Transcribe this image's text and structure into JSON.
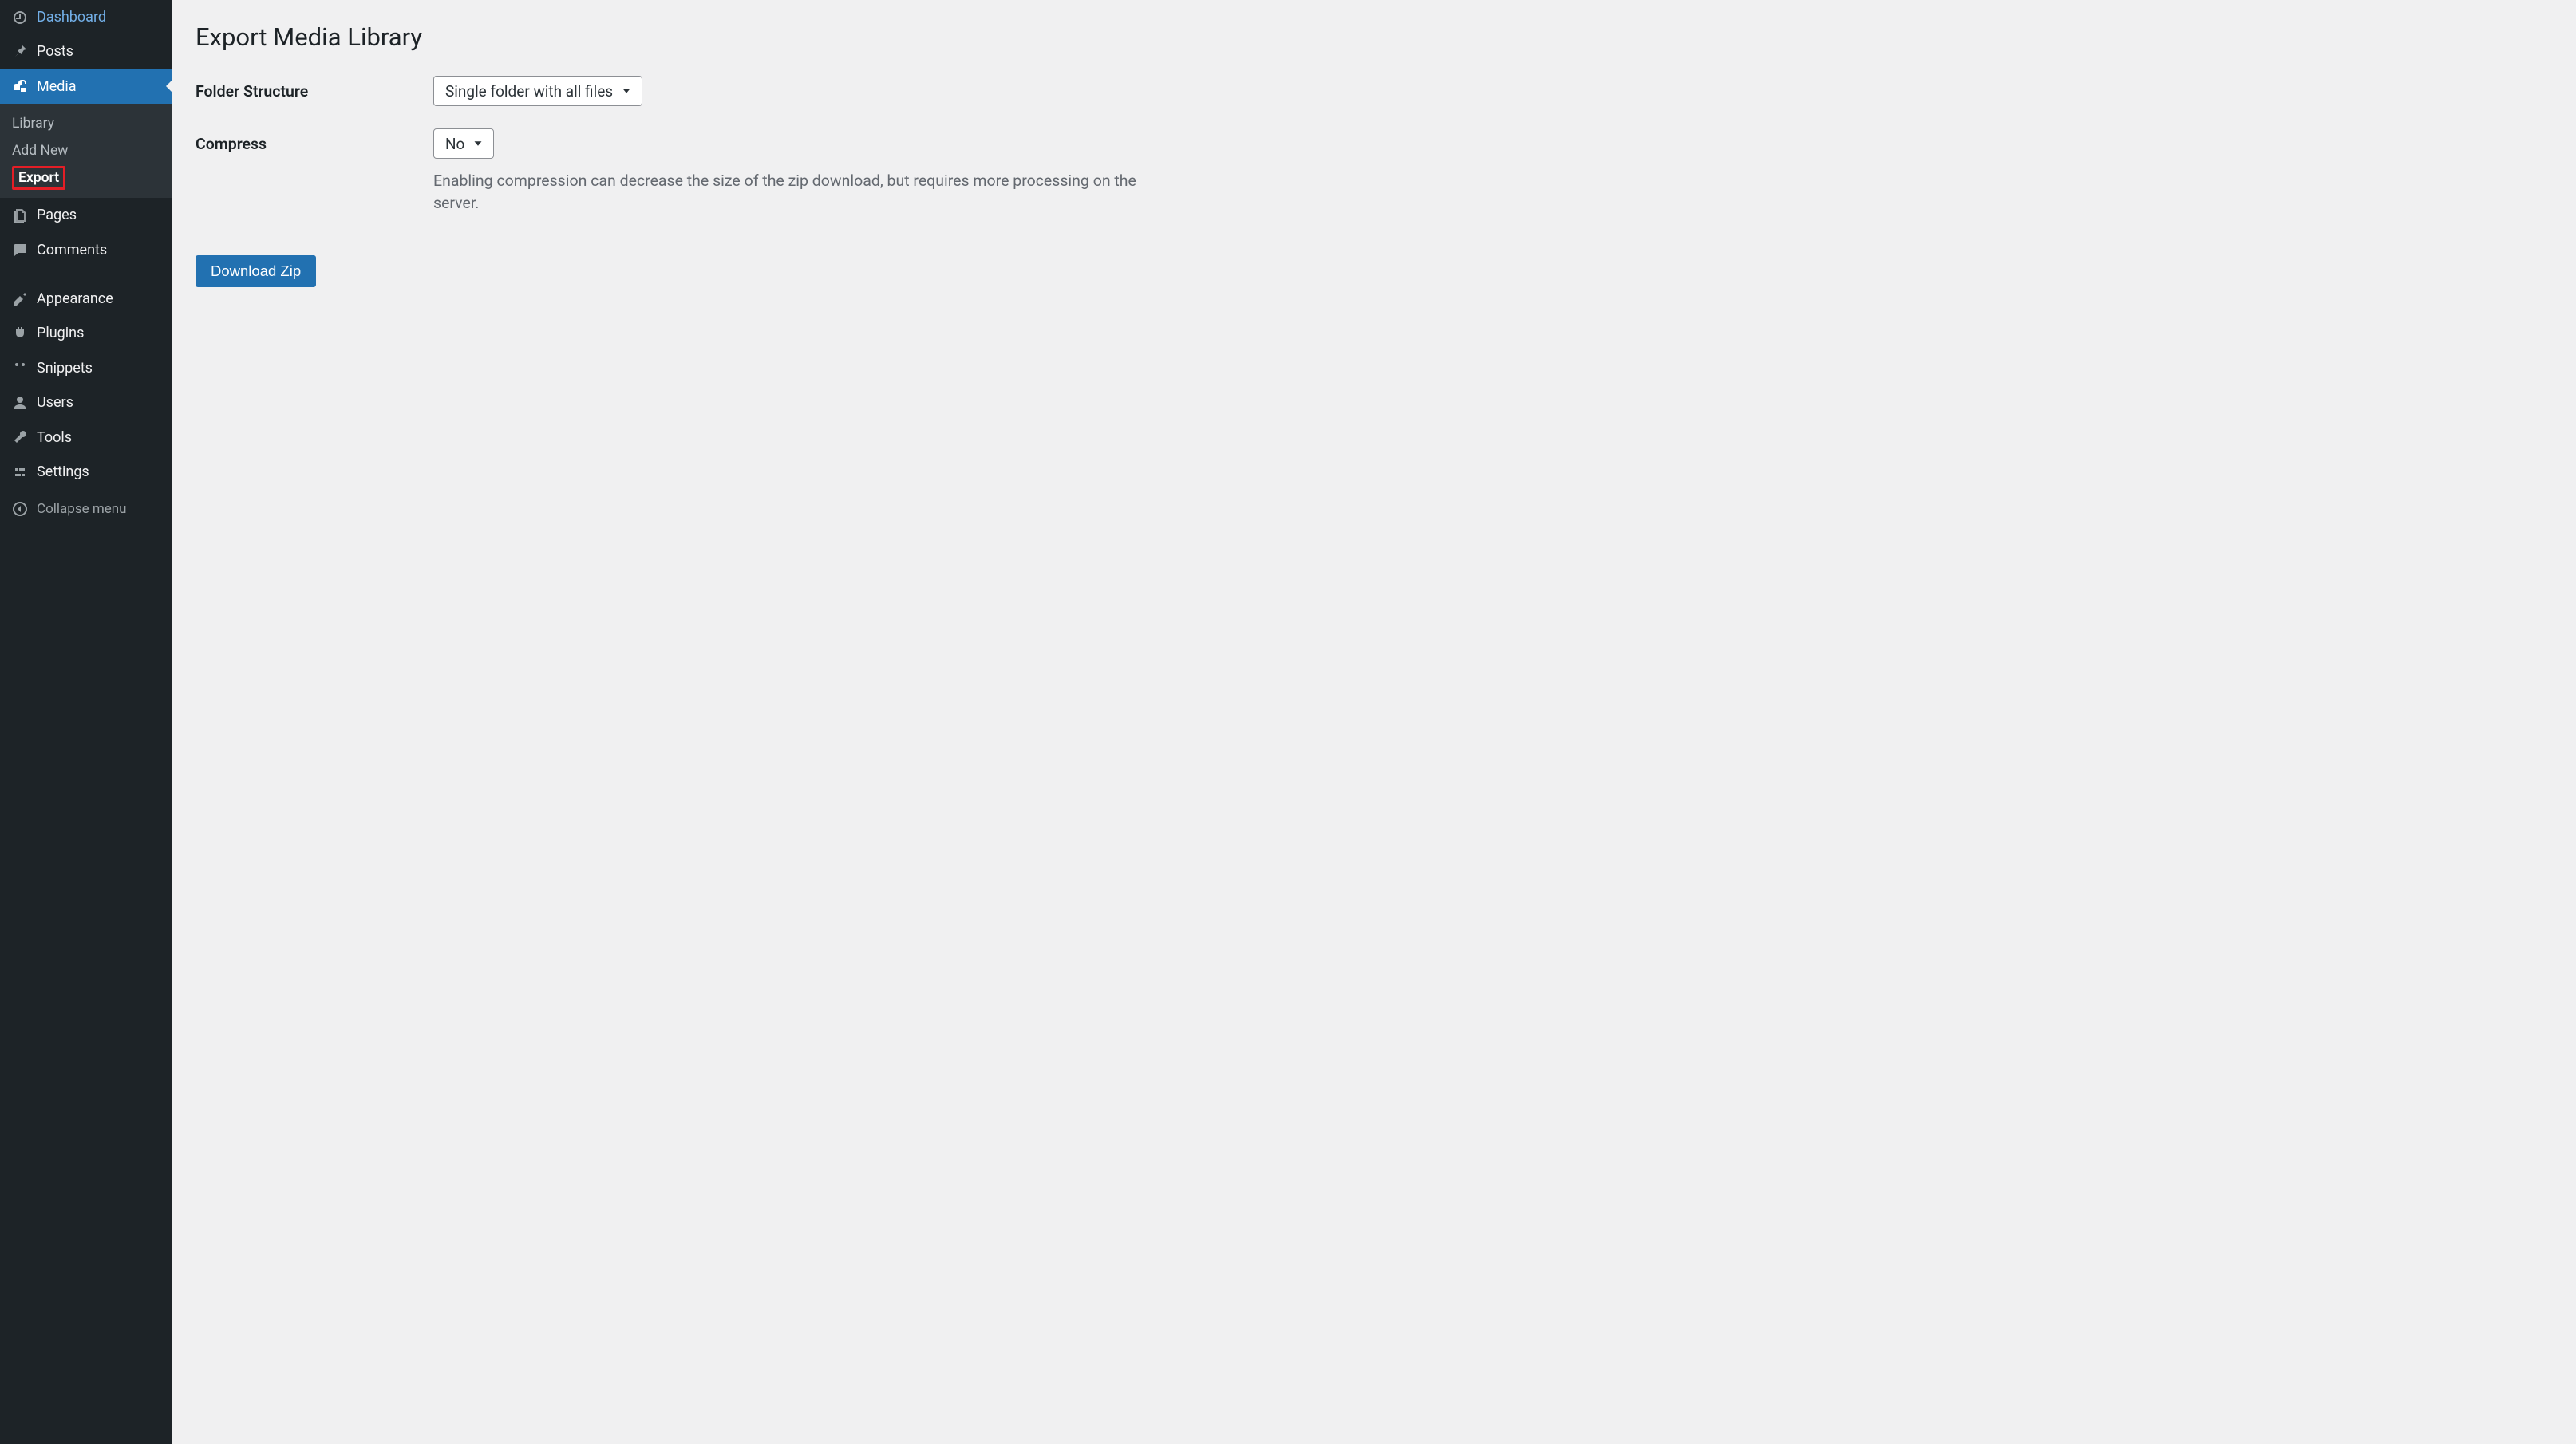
{
  "sidebar": {
    "dashboard": "Dashboard",
    "posts": "Posts",
    "media": "Media",
    "media_sub": {
      "library": "Library",
      "add_new": "Add New",
      "export": "Export"
    },
    "pages": "Pages",
    "comments": "Comments",
    "appearance": "Appearance",
    "plugins": "Plugins",
    "snippets": "Snippets",
    "users": "Users",
    "tools": "Tools",
    "settings": "Settings",
    "collapse": "Collapse menu"
  },
  "page": {
    "title": "Export Media Library",
    "folder_structure_label": "Folder Structure",
    "folder_structure_value": "Single folder with all files",
    "compress_label": "Compress",
    "compress_value": "No",
    "compress_help": "Enabling compression can decrease the size of the zip download, but requires more processing on the server.",
    "download_btn": "Download Zip"
  }
}
